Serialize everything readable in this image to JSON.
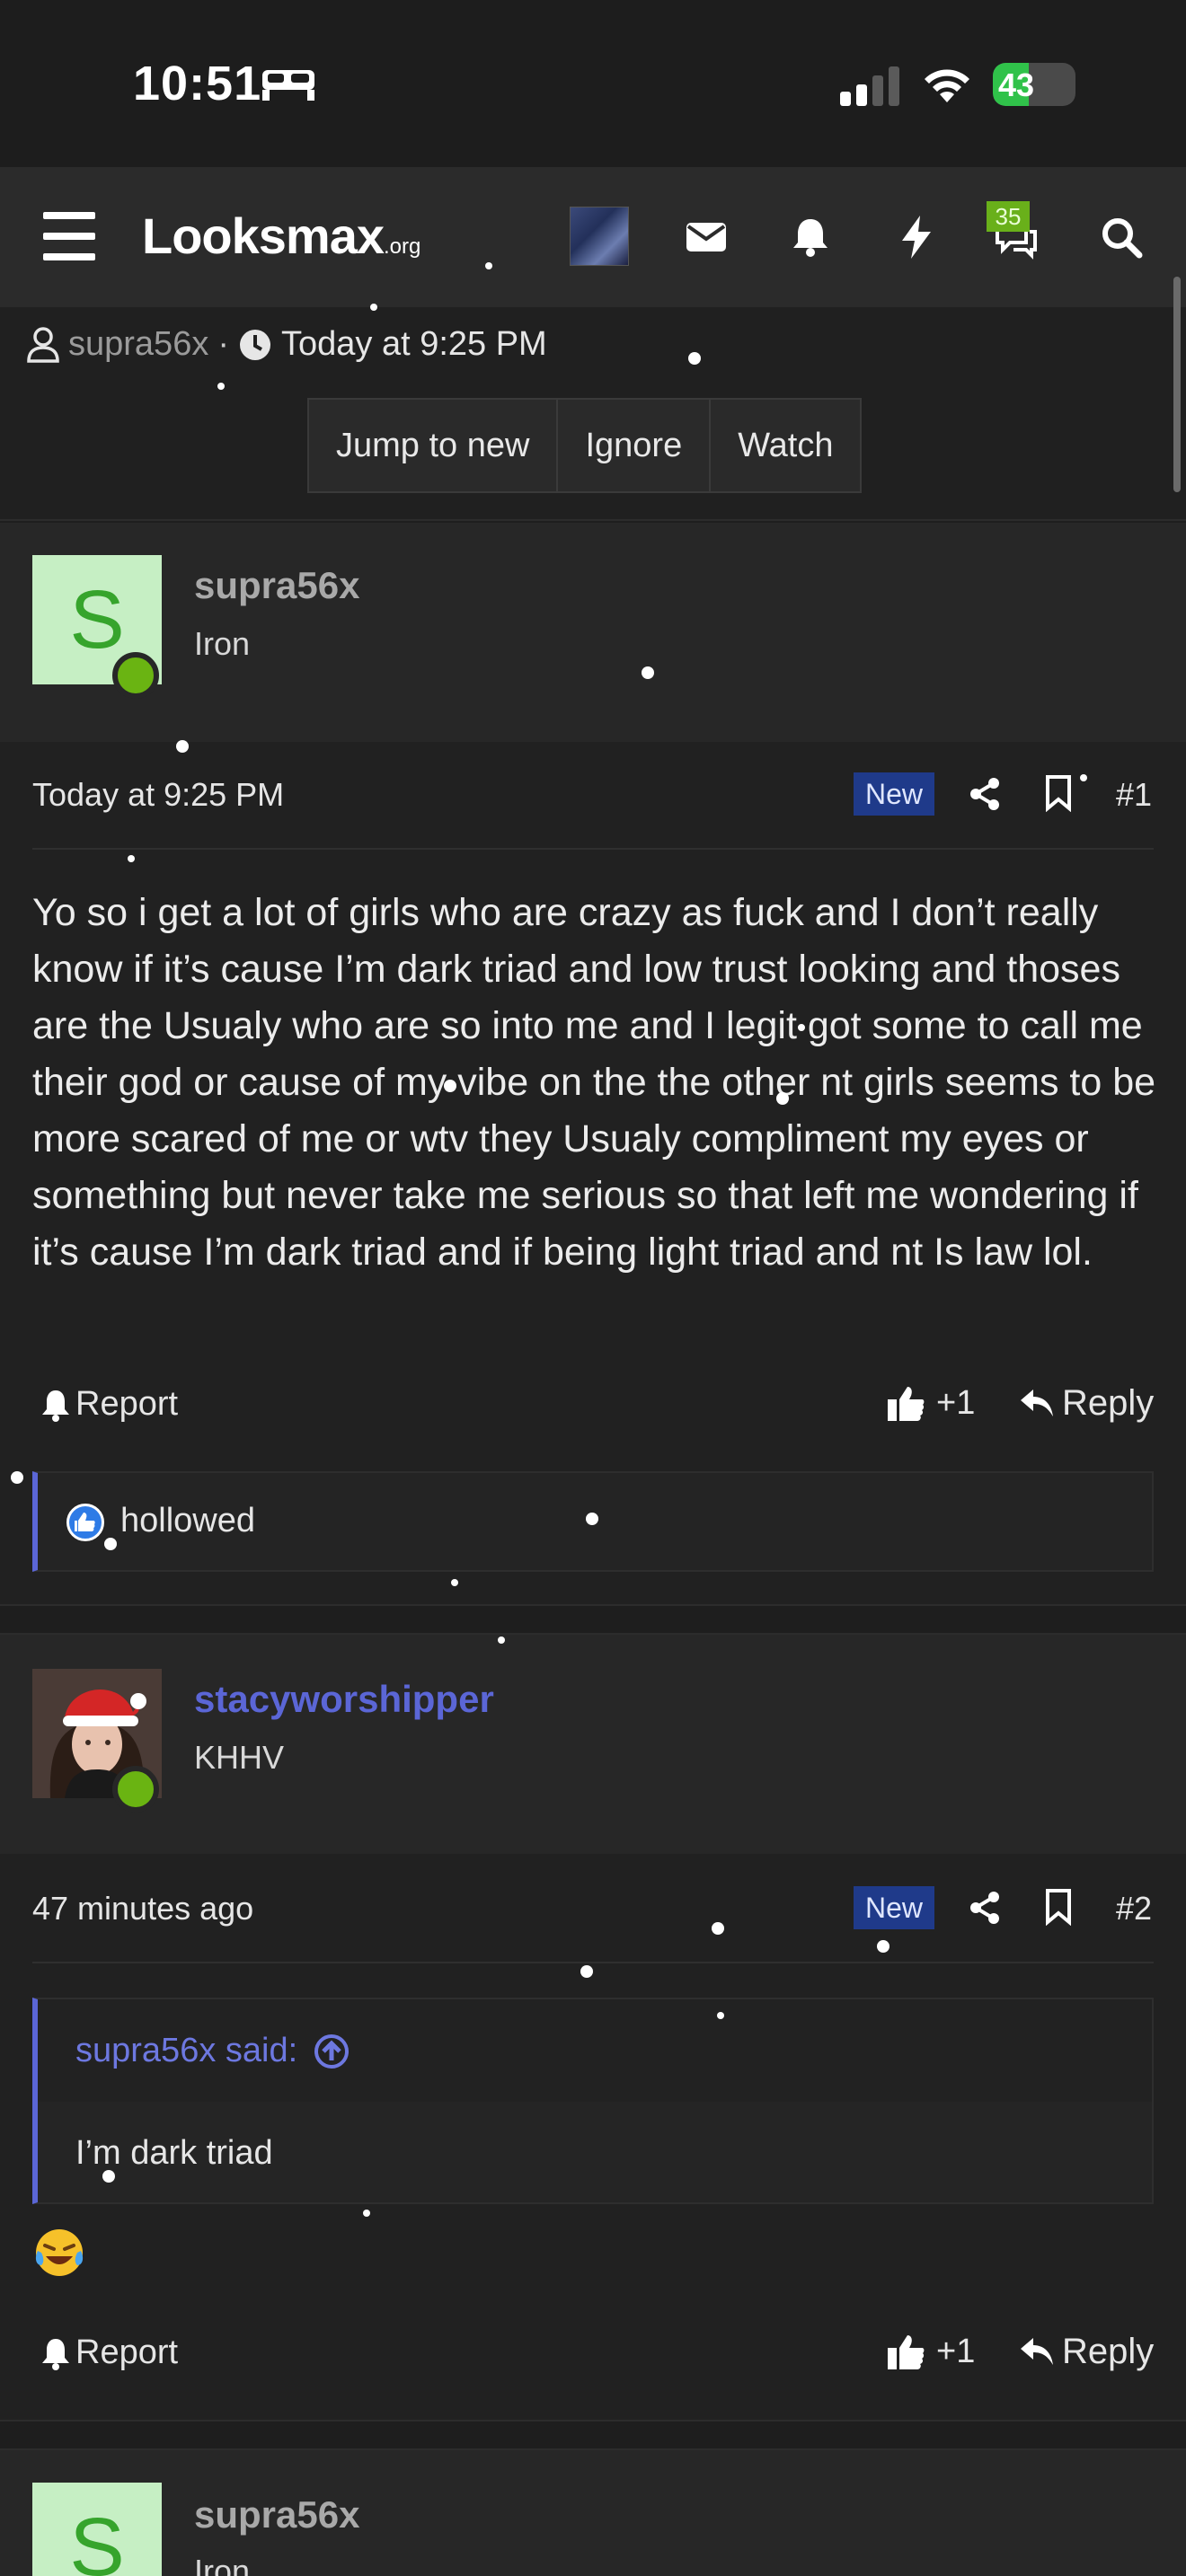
{
  "status_bar": {
    "time": "10:51",
    "battery": "43",
    "battery_level": 0.43
  },
  "nav": {
    "logo_main": "Looksmax",
    "logo_suffix": ".org",
    "conversations_badge": "35"
  },
  "thread": {
    "author": "supra56x",
    "separator": "·",
    "date": "Today at 9:25 PM",
    "buttons": [
      "Jump to new",
      "Ignore",
      "Watch"
    ]
  },
  "posts": [
    {
      "avatar_letter": "S",
      "username": "supra56x",
      "user_title": "Iron",
      "date": "Today at 9:25 PM",
      "badge": "New",
      "number": "#1",
      "body": "Yo so i get a lot of girls who are crazy as fuck and I don’t really know if it’s cause I’m dark triad and low trust looking and thoses are the Usualy who are so into me and I legit got some to call me their god or cause of my vibe on the the other nt girls seems to be more scared of me or wtv they Usualy compliment my eyes or something but never take me serious so that left me wondering if it’s cause I’m dark triad and if being light triad and nt Is law lol.",
      "report": "Report",
      "likes": "+1",
      "reply": "Reply",
      "reaction_user": "hollowed"
    },
    {
      "username": "stacyworshipper",
      "user_title": "KHHV",
      "date": "47 minutes ago",
      "badge": "New",
      "number": "#2",
      "quote_author": "supra56x said:",
      "quote_text": "I’m dark triad",
      "report": "Report",
      "likes": "+1",
      "reply": "Reply"
    },
    {
      "avatar_letter": "S",
      "username": "supra56x",
      "user_title": "Iron"
    }
  ],
  "colors": {
    "accent": "#5b66d6",
    "online": "#6ab412",
    "new_badge": "#1f3a8a"
  }
}
